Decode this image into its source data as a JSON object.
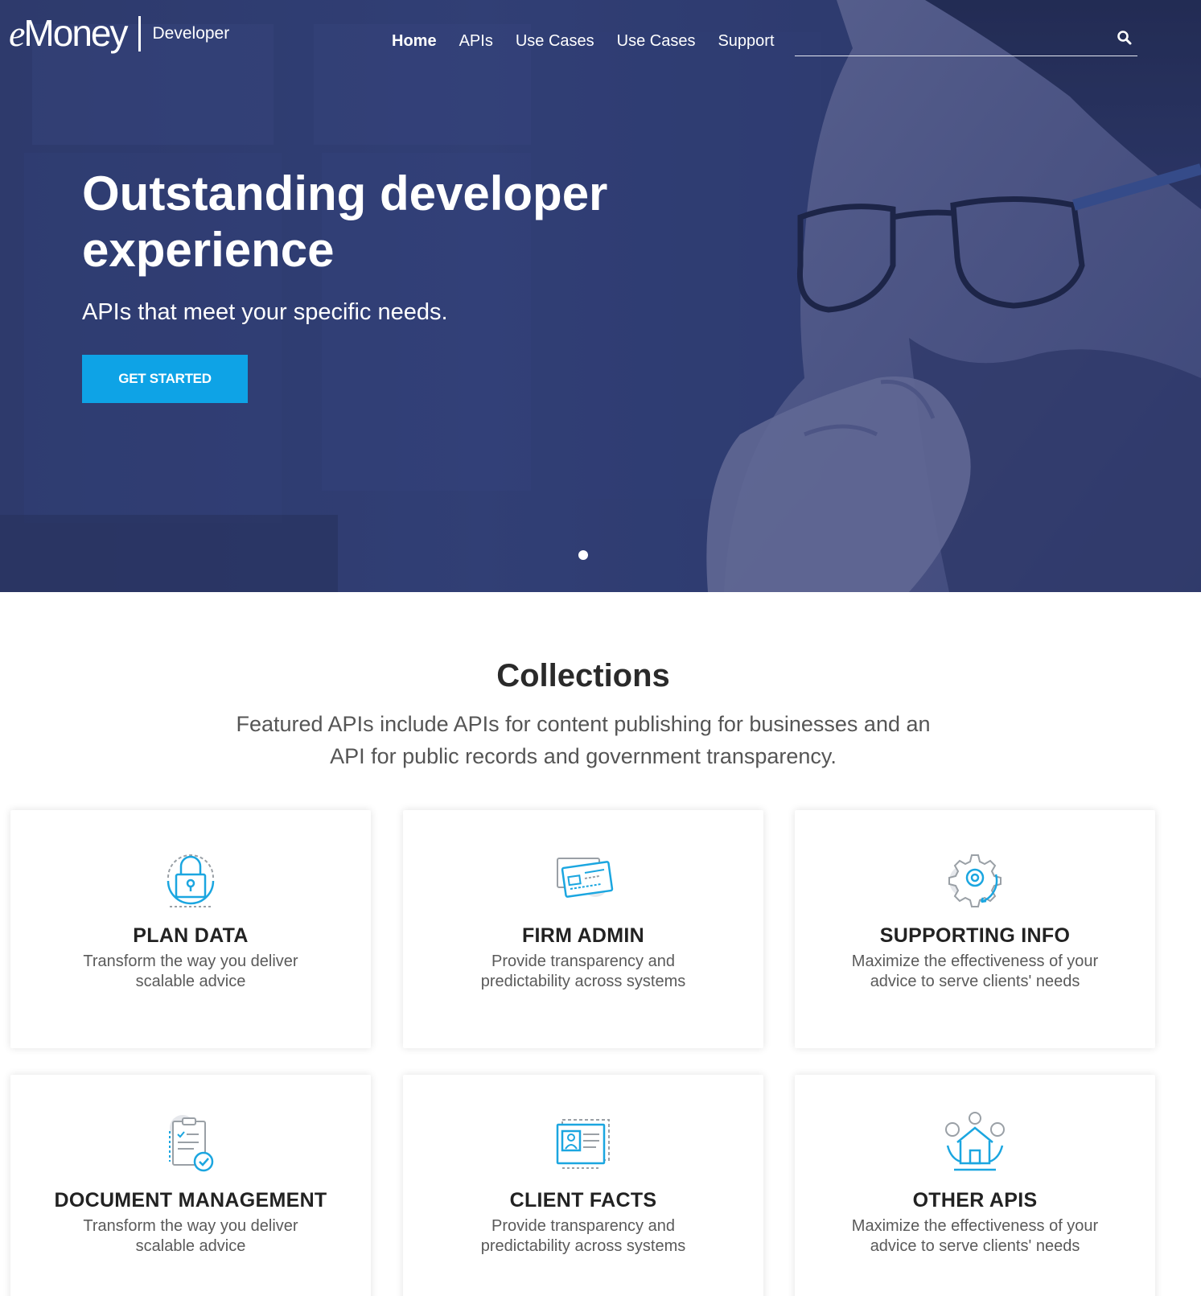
{
  "brand": {
    "logo_e": "e",
    "logo_rest": "Money",
    "section": "Developer"
  },
  "nav": {
    "items": [
      {
        "label": "Home",
        "active": true
      },
      {
        "label": "APIs",
        "active": false
      },
      {
        "label": "Use Cases",
        "active": false
      },
      {
        "label": "Use Cases",
        "active": false
      },
      {
        "label": "Support",
        "active": false
      }
    ]
  },
  "search": {
    "value": "",
    "placeholder": "",
    "icon": "search-icon"
  },
  "hero": {
    "title": "Outstanding developer experience",
    "subtitle": "APIs that meet your specific needs.",
    "cta_label": "GET STARTED",
    "slide_count": 1,
    "active_slide": 1
  },
  "collections": {
    "title": "Collections",
    "description": "Featured APIs include APIs for content publishing for businesses and an API for public records and government transparency.",
    "cards": [
      {
        "title": "PLAN DATA",
        "text": "Transform the way you deliver scalable advice",
        "icon": "lock-icon"
      },
      {
        "title": "FIRM ADMIN",
        "text": "Provide transparency and predictability across systems",
        "icon": "id-card-icon"
      },
      {
        "title": "SUPPORTING INFO",
        "text": "Maximize the effectiveness of your advice to serve clients' needs",
        "icon": "gear-icon"
      },
      {
        "title": "DOCUMENT MANAGEMENT",
        "text": "Transform the way you deliver scalable advice",
        "icon": "clipboard-check-icon"
      },
      {
        "title": "CLIENT FACTS",
        "text": "Provide transparency and predictability across systems",
        "icon": "profile-card-icon"
      },
      {
        "title": "OTHER APIS",
        "text": "Maximize the effectiveness of your advice to serve clients' needs",
        "icon": "house-network-icon"
      }
    ]
  },
  "colors": {
    "accent": "#0ea3e6",
    "hero_overlay": "#2f3c70",
    "heading": "#2a2a2a",
    "body_text": "#5a5a5a",
    "icon_blue": "#1ba6e0",
    "icon_gray": "#9aa0a6"
  }
}
